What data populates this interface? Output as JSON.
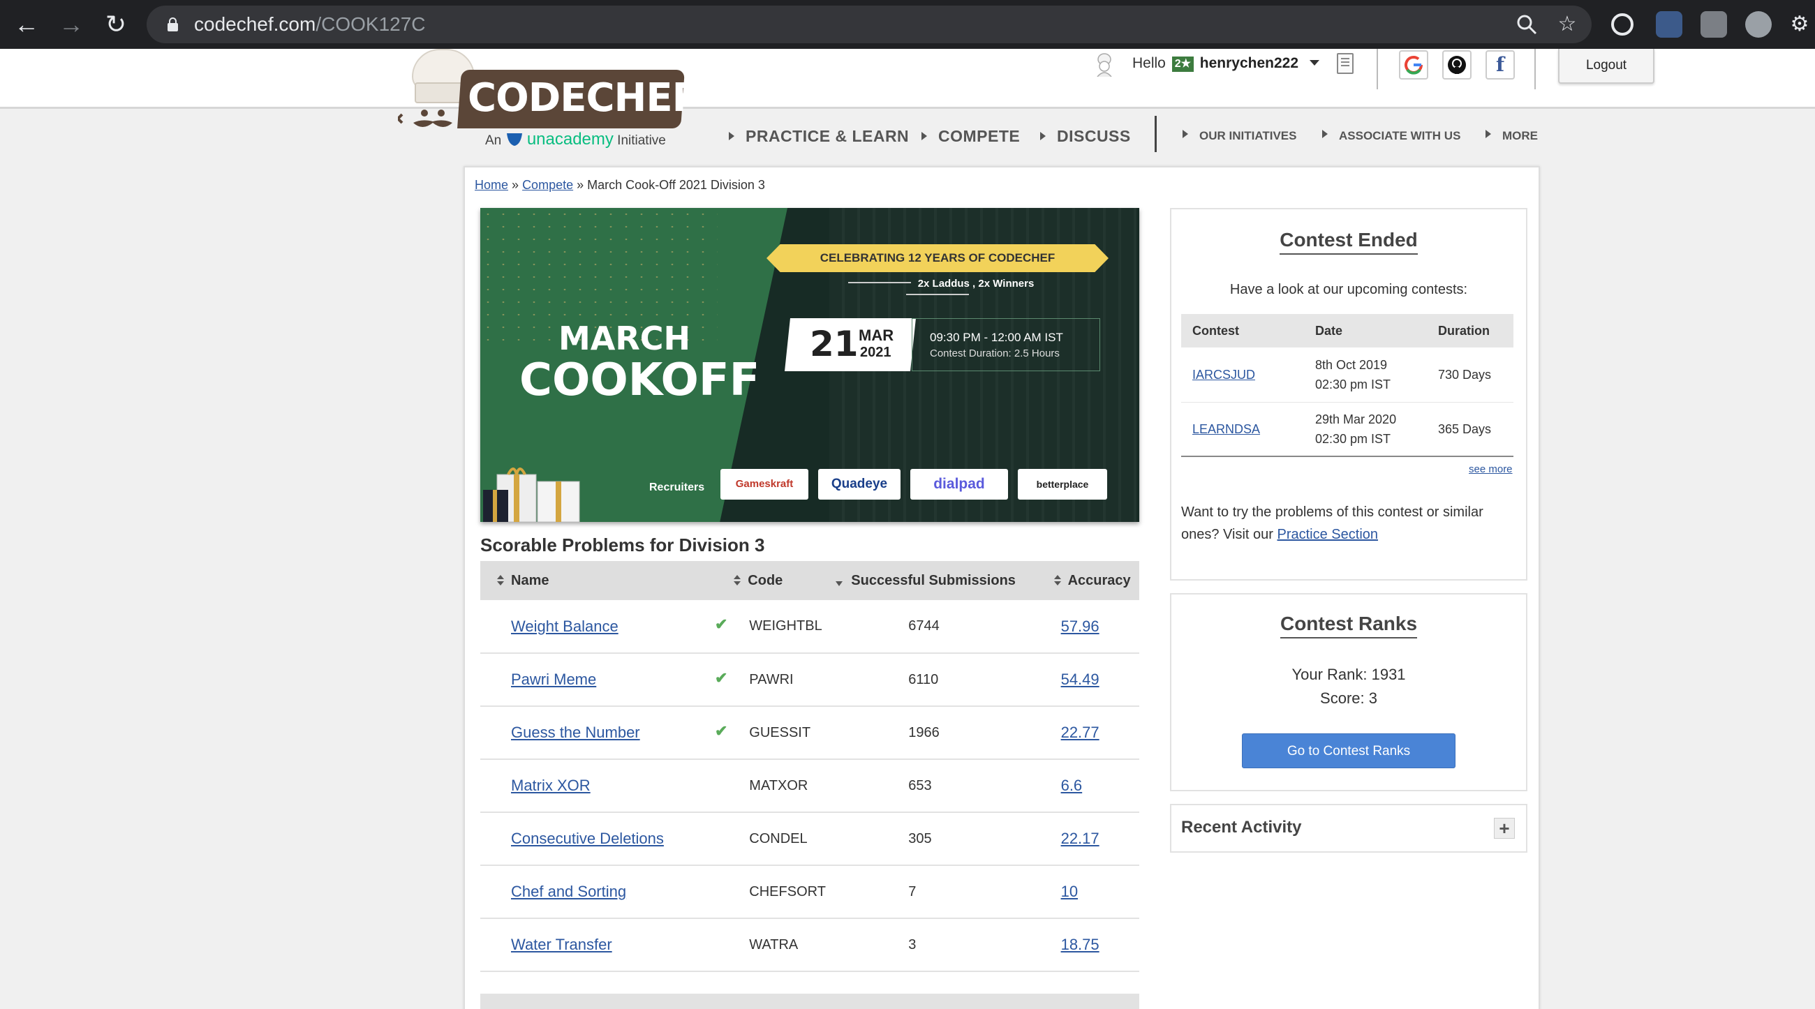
{
  "browser": {
    "url_host": "codechef.com",
    "url_path": "/COOK127C"
  },
  "header": {
    "logo_text": "CODECHEF",
    "tagline_pre": "An",
    "tagline_brand": "unacademy",
    "tagline_post": "Initiative",
    "hello": "Hello",
    "user_stars": "2★",
    "username": "henrychen222",
    "logout": "Logout"
  },
  "nav": {
    "items": [
      "PRACTICE & LEARN",
      "COMPETE",
      "DISCUSS",
      "OUR INITIATIVES",
      "ASSOCIATE WITH US",
      "MORE"
    ]
  },
  "breadcrumb": {
    "home": "Home",
    "sep": "»",
    "compete": "Compete",
    "current": "March Cook-Off 2021 Division 3"
  },
  "banner": {
    "title1": "MARCH",
    "title2": "COOKOFF",
    "ribbon": "CELEBRATING 12 YEARS OF CODECHEF",
    "prize": "2x Laddus , 2x Winners",
    "day": "21",
    "month": "MAR",
    "year": "2021",
    "time": "09:30 PM - 12:00 AM IST",
    "duration": "Contest Duration: 2.5 Hours",
    "recruiters": "Recruiters",
    "sponsors": [
      "Gameskraft",
      "Quadeye",
      "dialpad",
      "betterplace"
    ]
  },
  "problems": {
    "title": "Scorable Problems for Division 3",
    "headers": {
      "name": "Name",
      "code": "Code",
      "submissions": "Successful Submissions",
      "accuracy": "Accuracy"
    },
    "rows": [
      {
        "name": "Weight Balance",
        "solved": true,
        "code": "WEIGHTBL",
        "submissions": "6744",
        "accuracy": "57.96"
      },
      {
        "name": "Pawri Meme",
        "solved": true,
        "code": "PAWRI",
        "submissions": "6110",
        "accuracy": "54.49"
      },
      {
        "name": "Guess the Number",
        "solved": true,
        "code": "GUESSIT",
        "submissions": "1966",
        "accuracy": "22.77"
      },
      {
        "name": "Matrix XOR",
        "solved": false,
        "code": "MATXOR",
        "submissions": "653",
        "accuracy": "6.6"
      },
      {
        "name": "Consecutive Deletions",
        "solved": false,
        "code": "CONDEL",
        "submissions": "305",
        "accuracy": "22.17"
      },
      {
        "name": "Chef and Sorting",
        "solved": false,
        "code": "CHEFSORT",
        "submissions": "7",
        "accuracy": "10"
      },
      {
        "name": "Water Transfer",
        "solved": false,
        "code": "WATRA",
        "submissions": "3",
        "accuracy": "18.75"
      }
    ],
    "check_glyph": "✔"
  },
  "contest_ended": {
    "title": "Contest Ended",
    "subtitle": "Have a look at our upcoming contests:",
    "headers": {
      "contest": "Contest",
      "date": "Date",
      "duration": "Duration"
    },
    "rows": [
      {
        "contest": "IARCSJUD",
        "date1": "8th Oct 2019",
        "date2": "02:30 pm IST",
        "duration": "730 Days"
      },
      {
        "contest": "LEARNDSA",
        "date1": "29th Mar 2020",
        "date2": "02:30 pm IST",
        "duration": "365 Days"
      }
    ],
    "see_more": "see more",
    "practice_text": "Want to try the problems of this contest or similar ones? Visit our",
    "practice_link": "Practice Section"
  },
  "ranks": {
    "title": "Contest Ranks",
    "rank": "Your Rank: 1931",
    "score": "Score: 3",
    "button": "Go to Contest Ranks"
  },
  "recent": {
    "title": "Recent Activity",
    "toggle": "+"
  },
  "colors": {
    "link": "#2c57a0",
    "brand_brown": "#5b4638",
    "banner_green": "#2f7047",
    "button_blue": "#4a84d6",
    "check_green": "#5aab5a"
  }
}
